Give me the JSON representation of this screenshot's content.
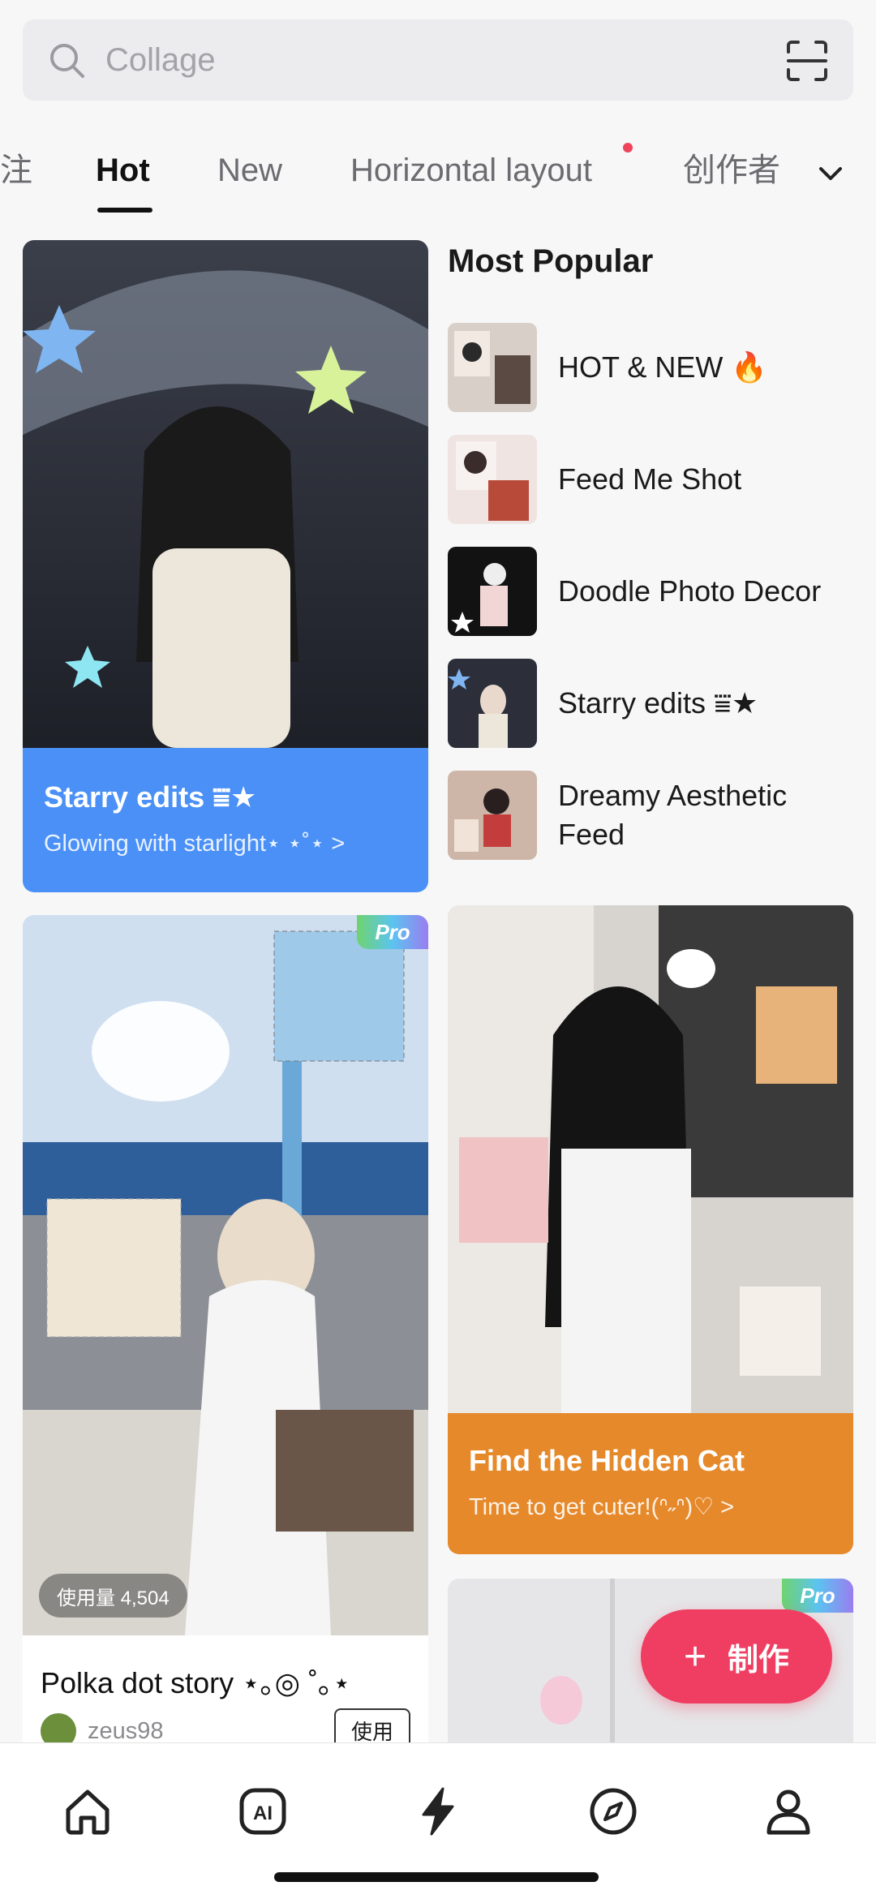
{
  "search": {
    "placeholder": "Collage"
  },
  "tabs": [
    {
      "label": "注"
    },
    {
      "label": "Hot"
    },
    {
      "label": "New"
    },
    {
      "label": "Horizontal layout"
    },
    {
      "label": "创作者"
    }
  ],
  "featured": {
    "title": "Starry edits ⩸★",
    "subtitle": "Glowing with starlight⋆ ⋆˚⋆ >"
  },
  "most_popular": {
    "title": "Most Popular",
    "items": [
      {
        "label": "HOT & NEW 🔥"
      },
      {
        "label": "Feed Me Shot"
      },
      {
        "label": "Doodle Photo Decor"
      },
      {
        "label": "Starry edits ⩸★"
      },
      {
        "label": "Dreamy Aesthetic Feed"
      }
    ]
  },
  "polka": {
    "badge": "Pro",
    "usage": "使用量 4,504",
    "title": "Polka dot story ⋆｡◎ ˚｡⋆",
    "author": "zeus98",
    "use_label": "使用"
  },
  "hidden_cat": {
    "title": "Find the Hidden Cat",
    "subtitle": "Time to get cuter!(ᐢ˶ᐢ)♡ >"
  },
  "card4": {
    "badge": "Pro"
  },
  "fab": {
    "plus": "+",
    "label": "制作"
  },
  "colors": {
    "accent_blue": "#4a90f6",
    "accent_orange": "#e6892b",
    "fab_pink": "#f03e62"
  }
}
